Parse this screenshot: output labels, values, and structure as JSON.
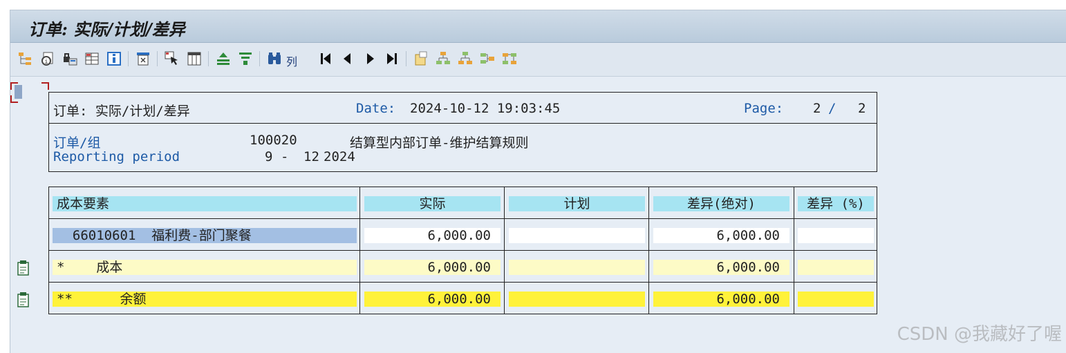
{
  "window": {
    "title": "订单: 实际/计划/差异"
  },
  "toolbar": {
    "icons": [
      "hierarchy-icon",
      "copy-info-icon",
      "lock-print-icon",
      "grid-layout-icon",
      "info-icon",
      "print-preview-icon",
      "select-cursor-icon",
      "columns-icon",
      "sum-up-icon",
      "filter-icon",
      "find-binoculars-icon",
      "first-page-icon",
      "previous-page-icon",
      "next-page-icon",
      "last-page-icon",
      "new-doc-icon",
      "expand-tree-icon",
      "collapse-tree-icon",
      "tree-node-icon",
      "tree-config-icon"
    ],
    "column_label": "列"
  },
  "report_header": {
    "title": "订单: 实际/计划/差异",
    "date_label": "Date:",
    "date_value": "2024-10-12 19:03:45",
    "page_label": "Page:",
    "page_current": "2",
    "page_sep": "/",
    "page_total": "2",
    "order_label": "订单/组",
    "order_value": "100020",
    "order_desc": "结算型内部订单-维护结算规则",
    "period_label": "Reporting period",
    "period_from": "9",
    "period_dash": "-",
    "period_to": "12",
    "period_year": "2024"
  },
  "table": {
    "columns": [
      "成本要素",
      "实际",
      "计划",
      "差异(绝对)",
      "差异 (%)"
    ],
    "rows": [
      {
        "element": "  66010601  福利费-部门聚餐",
        "actual": "6,000.00",
        "plan": "",
        "var_abs": "6,000.00",
        "var_pct": ""
      },
      {
        "element": "*    成本",
        "actual": "6,000.00",
        "plan": "",
        "var_abs": "6,000.00",
        "var_pct": ""
      },
      {
        "element": "**      余额",
        "actual": "6,000.00",
        "plan": "",
        "var_abs": "6,000.00",
        "var_pct": ""
      }
    ]
  },
  "watermark": "CSDN @我藏好了喔",
  "colors": {
    "header_cyan": "#a6e4f2",
    "selected_blue": "#a3bfe3",
    "subtotal_yellow": "#fdfbc6",
    "total_yellow": "#fff23a",
    "label_blue": "#1d5aa6"
  }
}
